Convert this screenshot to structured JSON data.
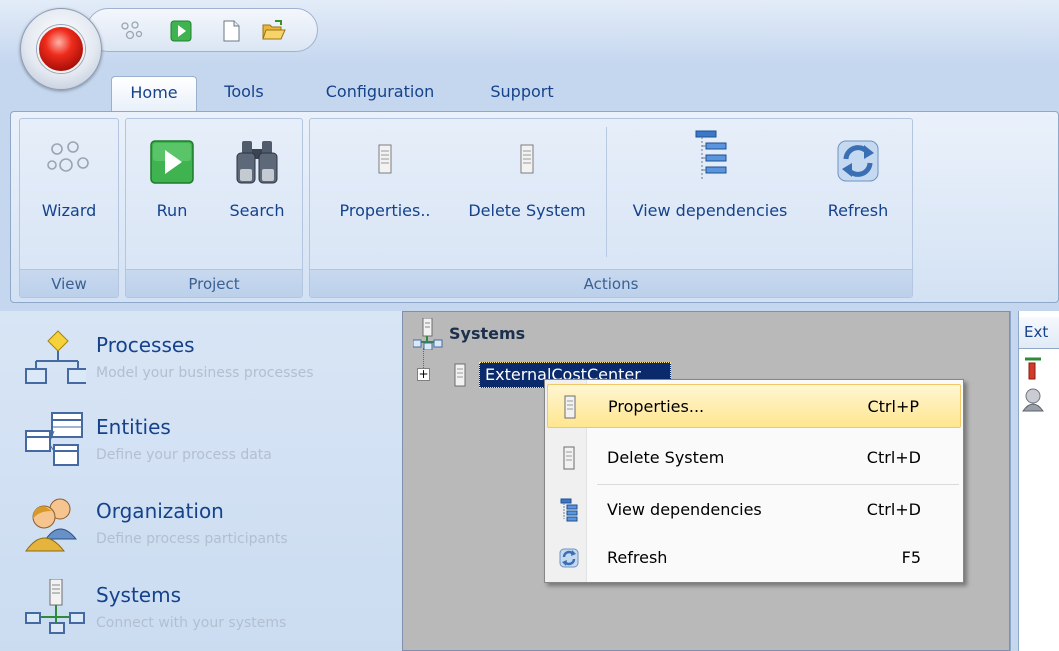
{
  "quick_access": {
    "icons": [
      "wizard-icon",
      "run-icon",
      "new-document-icon",
      "open-folder-icon"
    ]
  },
  "tabs": [
    {
      "label": "Home",
      "active": true
    },
    {
      "label": "Tools"
    },
    {
      "label": "Configuration"
    },
    {
      "label": "Support"
    }
  ],
  "ribbon": {
    "groups": {
      "view": {
        "label": "View",
        "buttons": {
          "wizard": "Wizard"
        }
      },
      "project": {
        "label": "Project",
        "buttons": {
          "run": "Run",
          "search": "Search"
        }
      },
      "actions": {
        "label": "Actions",
        "buttons": {
          "properties": "Properties..",
          "delete_system": "Delete System",
          "view_dependencies": "View dependencies",
          "refresh": "Refresh"
        }
      }
    }
  },
  "navigation": {
    "items": [
      {
        "title": "Processes",
        "description": "Model your business processes",
        "icon": "processes-icon"
      },
      {
        "title": "Entities",
        "description": "Define your process data",
        "icon": "entities-icon"
      },
      {
        "title": "Organization",
        "description": "Define process participants",
        "icon": "organization-icon"
      },
      {
        "title": "Systems",
        "description": "Connect with your systems",
        "icon": "systems-icon"
      }
    ]
  },
  "tree": {
    "root_label": "Systems",
    "selected_node": "ExternalCostCenter"
  },
  "context_menu": {
    "items": [
      {
        "label": "Properties...",
        "shortcut": "Ctrl+P",
        "highlighted": true,
        "icon": "server-icon"
      },
      {
        "label": "Delete System",
        "shortcut": "Ctrl+D",
        "icon": "server-icon"
      },
      {
        "label": "View dependencies",
        "shortcut": "Ctrl+D",
        "icon": "dependency-tree-icon"
      },
      {
        "label": "Refresh",
        "shortcut": "F5",
        "icon": "refresh-icon"
      }
    ]
  },
  "right_pane": {
    "tab_label": "Ext"
  },
  "colors": {
    "accent_text": "#15428b",
    "ribbon_bg": "#dbe7f6",
    "selection_bg": "#0a2a6b",
    "menu_highlight": "#ffe68f"
  }
}
